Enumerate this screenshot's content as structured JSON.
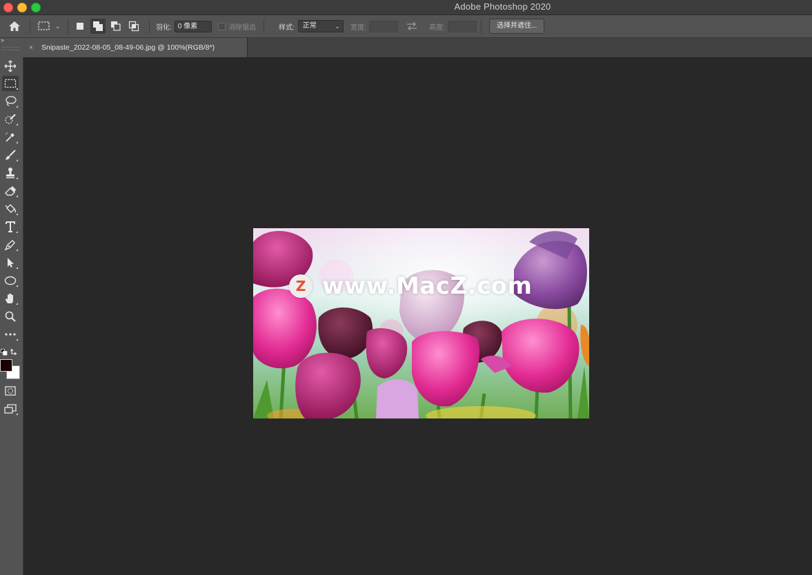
{
  "window": {
    "title": "Adobe Photoshop 2020"
  },
  "options_bar": {
    "feather_label": "羽化:",
    "feather_value": "0 像素",
    "antialias_label": "消除锯齿",
    "style_label": "样式:",
    "style_value": "正常",
    "width_label": "宽度:",
    "height_label": "高度:",
    "select_mask_button": "选择并遮住..."
  },
  "document_tab": {
    "close_glyph": "×",
    "title": "Snipaste_2022-08-05_08-49-06.jpg @ 100%(RGB/8*)"
  },
  "canvas": {
    "watermark_logo": "Z",
    "watermark_text": "www.MacZ.com"
  },
  "tools": [
    "move-tool",
    "rectangular-marquee-tool",
    "lasso-tool",
    "quick-selection-tool",
    "eyedropper-tool",
    "brush-tool",
    "clone-stamp-tool",
    "eraser-tool",
    "paint-bucket-tool",
    "type-tool",
    "pen-tool",
    "path-selection-tool",
    "ellipse-tool",
    "hand-tool",
    "zoom-tool",
    "edit-toolbar"
  ],
  "colors": {
    "foreground": "#1a0000",
    "background": "#ffffff",
    "ui_panel": "#535353",
    "canvas_bg": "#282828"
  }
}
